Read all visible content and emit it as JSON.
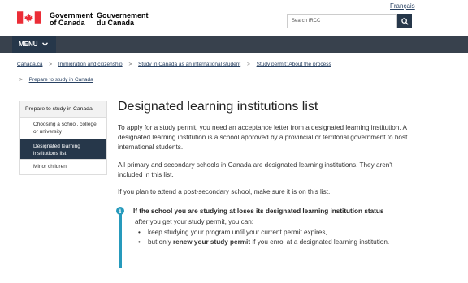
{
  "header": {
    "language_link": "Français",
    "gov_en_line1": "Government",
    "gov_en_line2": "of Canada",
    "gov_fr_line1": "Gouvernement",
    "gov_fr_line2": "du Canada",
    "search_placeholder": "Search IRCC",
    "menu_label": "MENU"
  },
  "breadcrumb": {
    "items": [
      "Canada.ca",
      "Immigration and citizenship",
      "Study in Canada as an international student",
      "Study permit: About the process"
    ],
    "second_row": "Prepare to study in Canada",
    "separator": ">"
  },
  "sidebar": {
    "heading": "Prepare to study in Canada",
    "items": [
      {
        "label": "Choosing a school, college or university",
        "active": false
      },
      {
        "label": "Designated learning institutions list",
        "active": true
      },
      {
        "label": "Minor children",
        "active": false
      }
    ]
  },
  "main": {
    "title": "Designated learning institutions list",
    "paragraphs": [
      "To apply for a study permit, you need an acceptance letter from a designated learning institution. A designated learning institution is a school approved by a provincial or territorial government to host international students.",
      "All primary and secondary schools in Canada are designated learning institutions. They aren't included in this list.",
      "If you plan to attend a post-secondary school, make sure it is on this list."
    ]
  },
  "alert": {
    "title": "If the school you are studying at loses its designated learning institution status",
    "after": "after you get your study permit, you can:",
    "bullets": [
      {
        "text": "keep studying your program until your current permit expires,"
      },
      {
        "prefix": "but only ",
        "bold": "renew your study permit",
        "suffix": " if you enrol at a designated learning institution."
      }
    ]
  },
  "colors": {
    "nav_dark": "#26374a",
    "menu_bar": "#38414d",
    "accent_red": "#af3c43",
    "info_blue": "#269abc",
    "link": "#284162",
    "flag_red": "#eb2d37"
  },
  "icons": {
    "search": "magnifier-icon",
    "menu_chevron": "chevron-down-icon",
    "alert": "info-icon",
    "flag": "canada-flag"
  }
}
